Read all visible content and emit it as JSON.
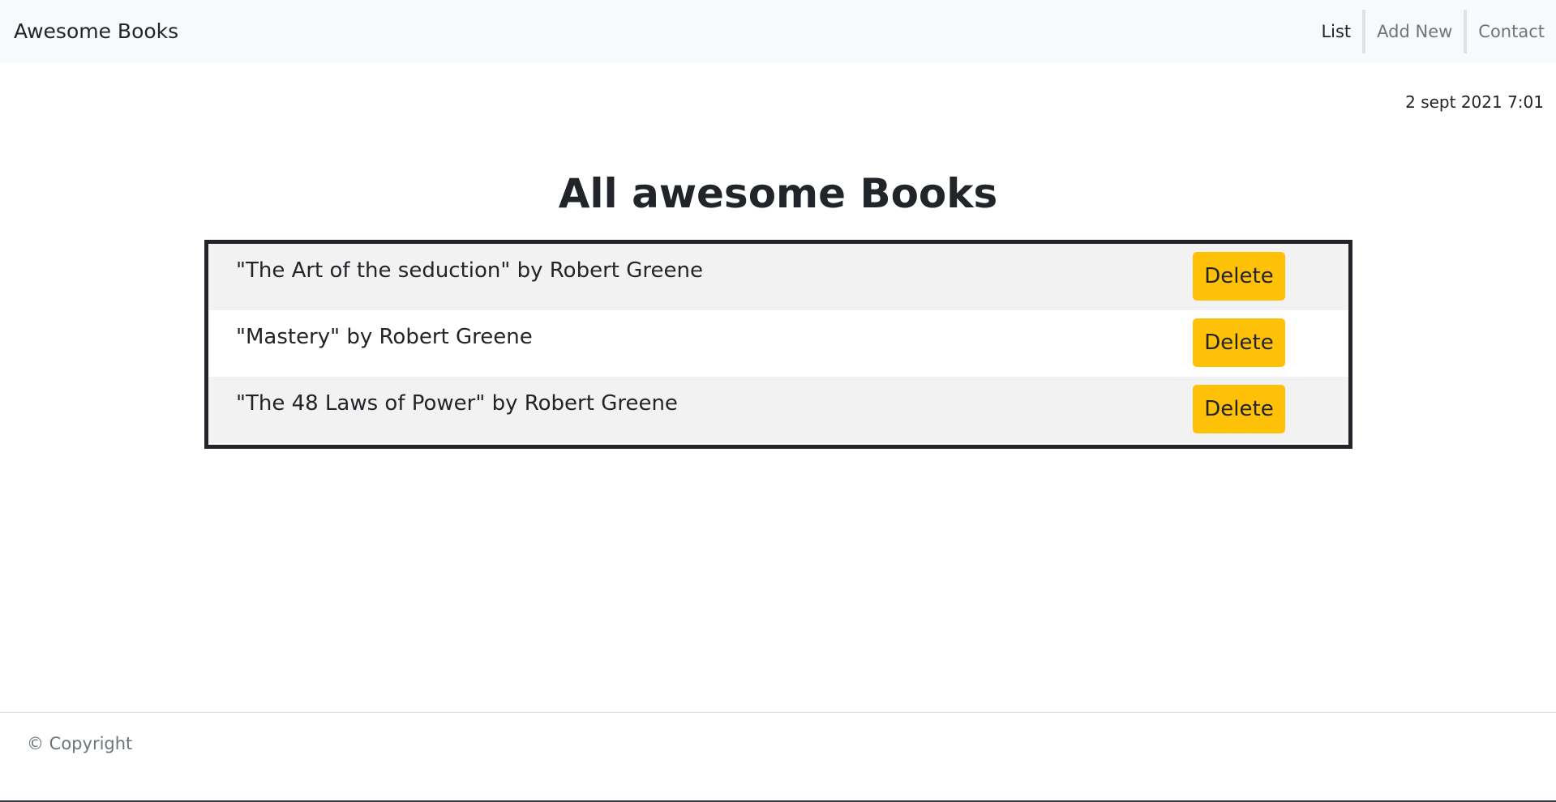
{
  "navbar": {
    "brand": "Awesome Books",
    "links": [
      {
        "label": "List",
        "active": true
      },
      {
        "label": "Add New",
        "active": false
      },
      {
        "label": "Contact",
        "active": false
      }
    ]
  },
  "date": "2 sept 2021 7:01",
  "main": {
    "title": "All awesome Books",
    "books": [
      {
        "text": "\"The Art of the seduction\" by Robert Greene",
        "delete_label": "Delete"
      },
      {
        "text": "\"Mastery\" by Robert Greene",
        "delete_label": "Delete"
      },
      {
        "text": "\"The 48 Laws of Power\" by Robert Greene",
        "delete_label": "Delete"
      }
    ]
  },
  "footer": {
    "copyright": "© Copyright"
  },
  "colors": {
    "navbar_bg": "#f8f9fa",
    "delete_button": "#ffc107",
    "row_stripe": "#f2f2f2",
    "border": "#212529"
  }
}
